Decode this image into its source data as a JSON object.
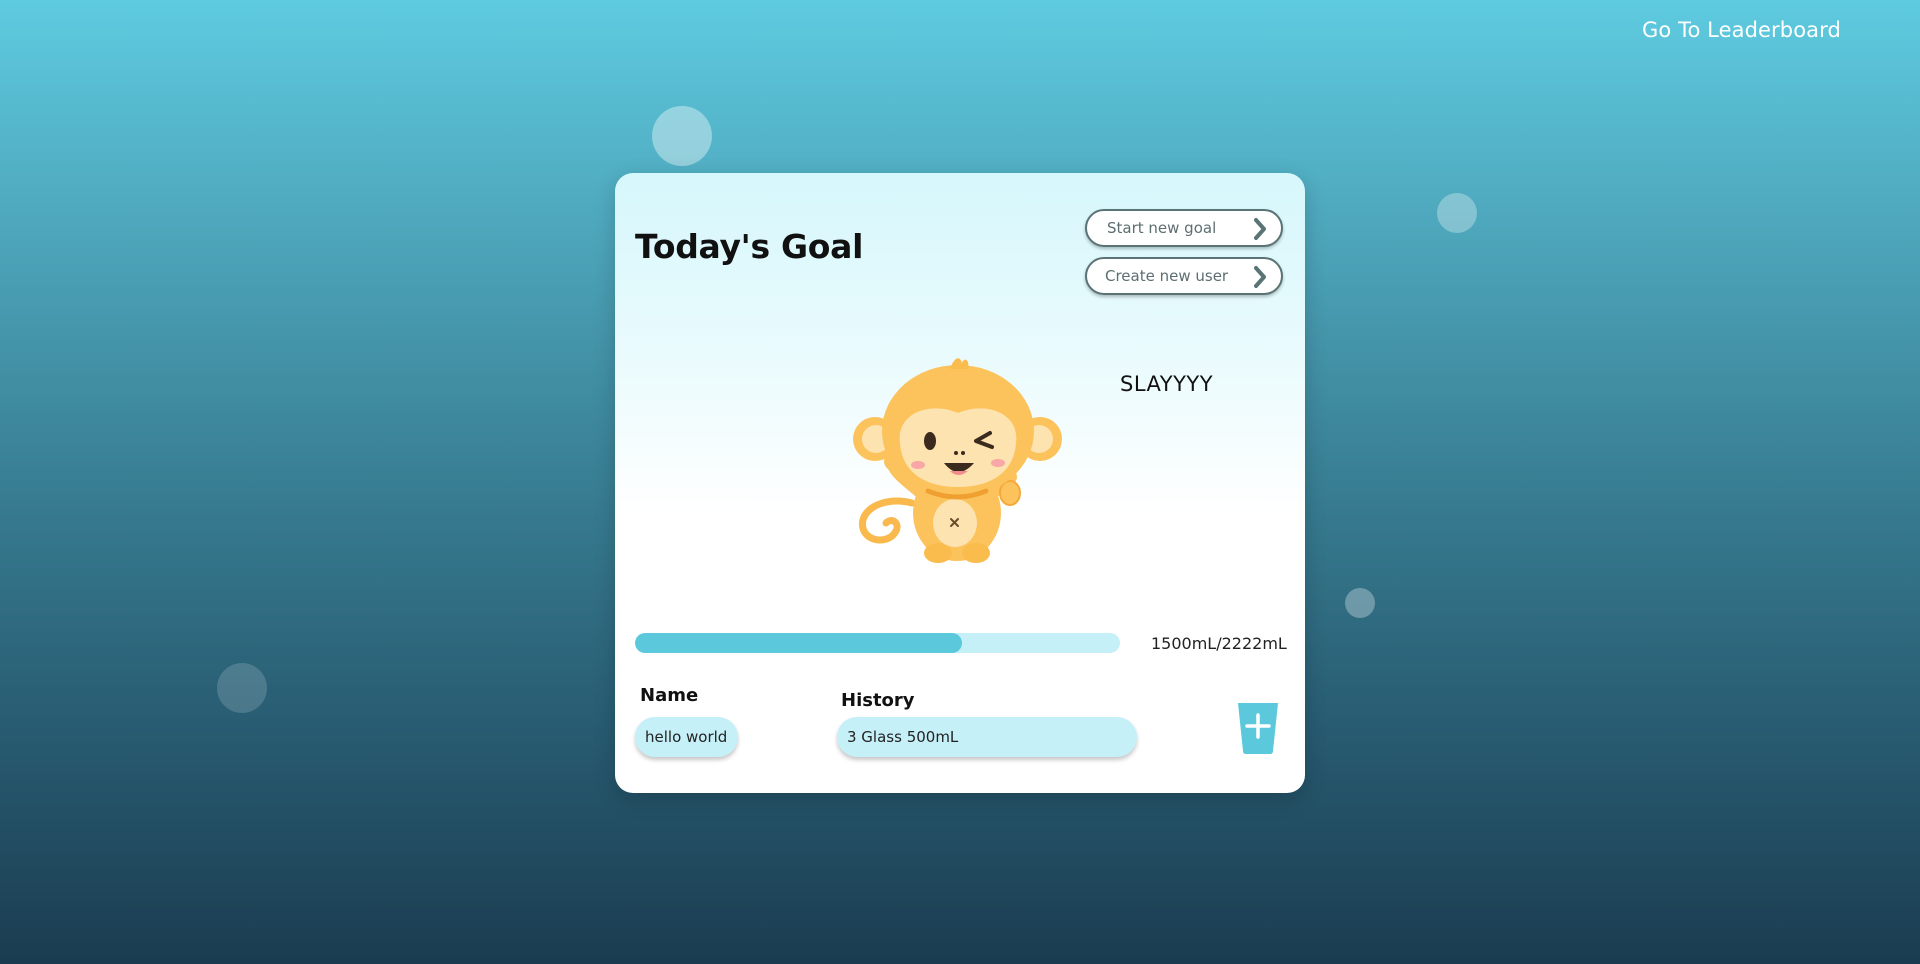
{
  "nav": {
    "leaderboard_label": "Go To Leaderboard"
  },
  "card": {
    "title": "Today's Goal",
    "start_goal_label": "Start new goal",
    "create_user_label": "Create new user",
    "status_message": "SLAYYYY",
    "progress": {
      "current_ml": 1500,
      "goal_ml": 2222,
      "fraction": 0.675,
      "text": "1500mL/2222mL"
    },
    "name": {
      "label": "Name",
      "value": "hello world"
    },
    "history": {
      "label": "History",
      "value": "3 Glass 500mL"
    }
  },
  "icons": {
    "chevron": "chevron-right-icon",
    "add": "cup-plus-icon",
    "mascot": "monkey-mascot"
  },
  "colors": {
    "accent": "#5bc8dc",
    "track": "#c6f0f8",
    "mascot": "#fcc35c"
  }
}
